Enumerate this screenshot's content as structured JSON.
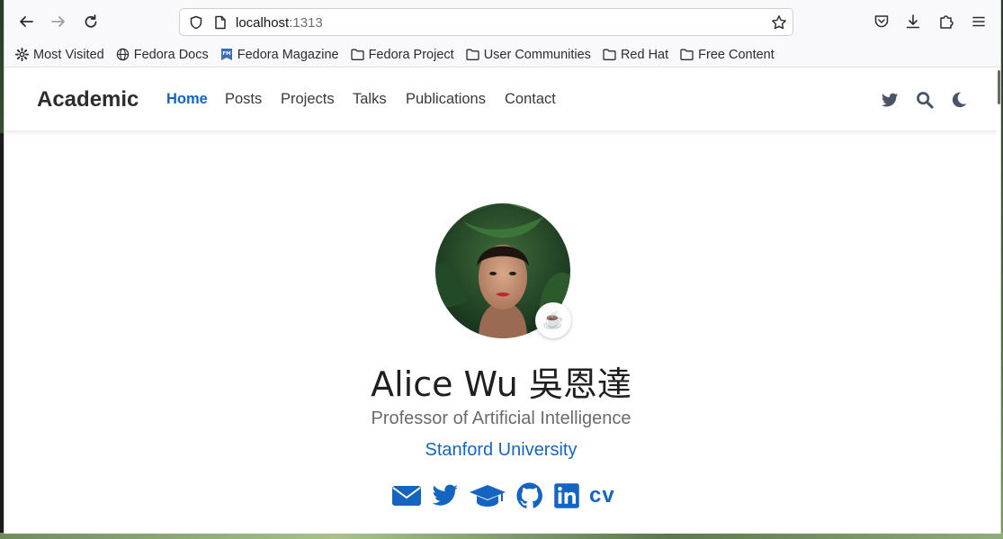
{
  "browser": {
    "url_host": "localhost",
    "url_port": ":1313",
    "bookmarks": [
      {
        "label": "Most Visited",
        "icon": "gear-icon"
      },
      {
        "label": "Fedora Docs",
        "icon": "globe-icon"
      },
      {
        "label": "Fedora Magazine",
        "icon": "fedora-magazine-icon"
      },
      {
        "label": "Fedora Project",
        "icon": "folder-icon"
      },
      {
        "label": "User Communities",
        "icon": "folder-icon"
      },
      {
        "label": "Red Hat",
        "icon": "folder-icon"
      },
      {
        "label": "Free Content",
        "icon": "folder-icon"
      }
    ]
  },
  "site": {
    "brand": "Academic",
    "nav": [
      "Home",
      "Posts",
      "Projects",
      "Talks",
      "Publications",
      "Contact"
    ],
    "active_nav": "Home",
    "accent_color": "#1565c0"
  },
  "profile": {
    "name": "Alice Wu 吳恩達",
    "role": "Professor of Artificial Intelligence",
    "organization": "Stanford University",
    "status_emoji": "☕",
    "social_icons": [
      "email-icon",
      "twitter-icon",
      "graduation-cap-icon",
      "github-icon",
      "linkedin-icon",
      "cv-icon"
    ],
    "cv_label": "cv"
  }
}
